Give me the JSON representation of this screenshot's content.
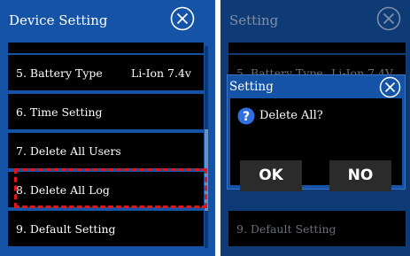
{
  "left_screen": {
    "title": "Device Setting",
    "items": [
      {
        "label": "5. Battery Type",
        "value": "Li-Ion 7.4v"
      },
      {
        "label": "6. Time Setting"
      },
      {
        "label": "7. Delete All Users"
      },
      {
        "label": "8. Delete All Log"
      },
      {
        "label": "9. Default Setting"
      }
    ]
  },
  "right_screen": {
    "title": "Setting",
    "items": [
      {
        "label": "5. Battery Type",
        "value": "Li-Ion 7.4V"
      },
      {
        "label": "9. Default Setting"
      }
    ],
    "dialog": {
      "title": "Setting",
      "message": "Delete All?",
      "ok_label": "OK",
      "no_label": "NO"
    }
  },
  "icons": {
    "close": "close-circle-icon",
    "question": "question-icon"
  },
  "colors": {
    "title_bar": "#1453a6",
    "highlight": "#e0161f",
    "row_background": "#000000"
  }
}
